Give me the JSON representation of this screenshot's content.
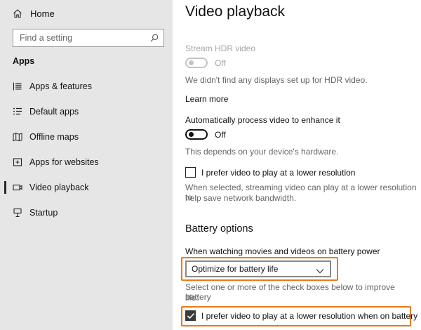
{
  "sidebar": {
    "home_label": "Home",
    "search_placeholder": "Find a setting",
    "section_title": "Apps",
    "items": [
      {
        "label": "Apps & features",
        "icon": "apps-features-icon"
      },
      {
        "label": "Default apps",
        "icon": "default-apps-icon"
      },
      {
        "label": "Offline maps",
        "icon": "offline-maps-icon"
      },
      {
        "label": "Apps for websites",
        "icon": "apps-for-websites-icon"
      },
      {
        "label": "Video playback",
        "icon": "video-playback-icon",
        "selected": true
      },
      {
        "label": "Startup",
        "icon": "startup-icon"
      }
    ]
  },
  "main": {
    "title": "Video playback",
    "hdr": {
      "label": "Stream HDR video",
      "toggle_state": "Off",
      "description": "We didn't find any displays set up for HDR video.",
      "learn_more": "Learn more"
    },
    "enhance": {
      "label": "Automatically process video to enhance it",
      "toggle_state": "Off",
      "description": "This depends on your device's hardware."
    },
    "lower_res": {
      "label": "I prefer video to play at a lower resolution",
      "checked": false,
      "description_line1": "When selected, streaming video can play at a lower resolution to",
      "description_line2": "help save network bandwidth."
    },
    "battery": {
      "heading": "Battery options",
      "dropdown_label": "When watching movies and videos on battery power",
      "dropdown_value": "Optimize for battery life",
      "hint_line1": "Select one or more of the check boxes below to improve battery",
      "hint_line2": "life:",
      "lower_res_battery_label": "I prefer video to play at a lower resolution when on battery",
      "lower_res_battery_checked": true
    }
  },
  "colors": {
    "sidebar_bg": "#e6e6e6",
    "highlight": "#ea7a1a",
    "disabled": "#a6a6a6"
  }
}
